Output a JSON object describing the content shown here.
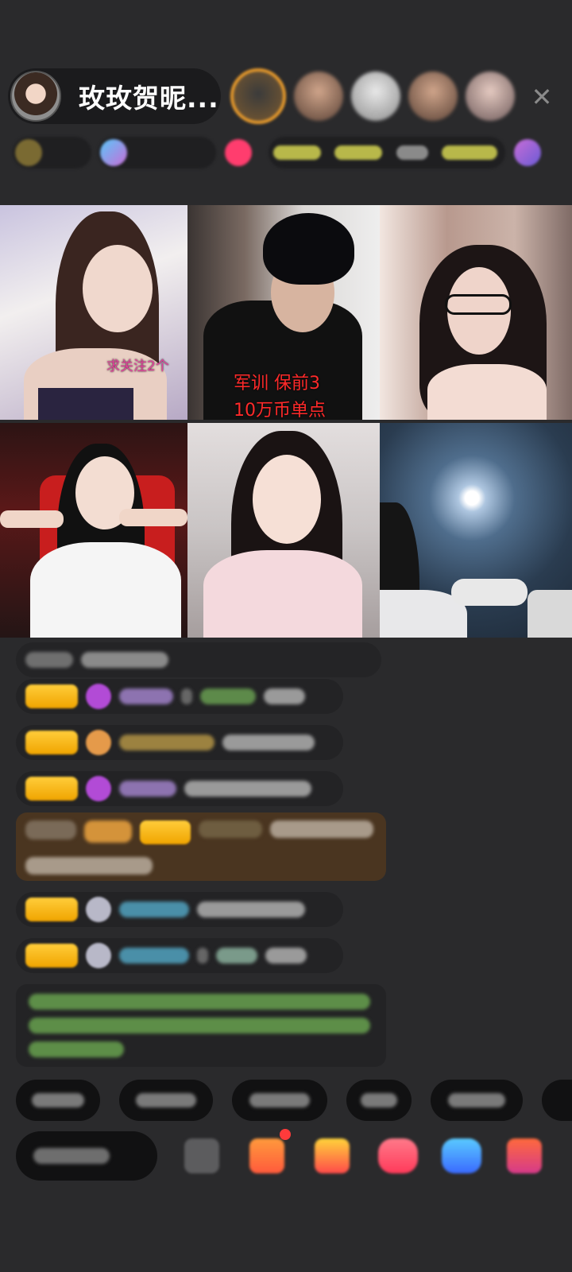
{
  "room": {
    "host_name": "玫玫贺昵...",
    "close_symbol": "✕"
  },
  "viewers": {
    "avatar_count": 5
  },
  "video_grid": {
    "tiles": [
      {
        "name": "tile-1",
        "caption": "求关注2个",
        "caption_color": "#e0409a"
      },
      {
        "name": "tile-2",
        "caption": "军训 保前3",
        "caption_line2": "10万币单点",
        "caption_color": "#ff2a2a"
      },
      {
        "name": "tile-3"
      },
      {
        "name": "tile-4"
      },
      {
        "name": "tile-5"
      },
      {
        "name": "tile-6"
      }
    ]
  },
  "colors": {
    "background": "#2a2a2c",
    "level_badge": "#f5b400",
    "gift_banner": "#4a3520",
    "system_msg_text": "#79c75f"
  }
}
